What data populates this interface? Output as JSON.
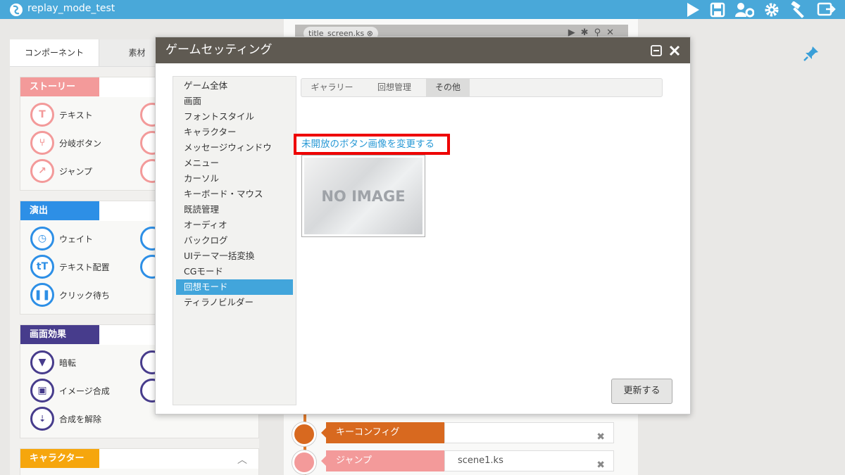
{
  "app": {
    "title": "replay_mode_test"
  },
  "toolbar": {
    "icons": [
      "play-icon",
      "save-icon",
      "users-gear-icon",
      "settings-icon",
      "hammer-icon",
      "export-icon"
    ]
  },
  "left_panel": {
    "tabs": [
      {
        "label": "コンポーネント"
      },
      {
        "label": "素材"
      }
    ],
    "categories": [
      {
        "label": "ストーリー",
        "color": "#f39a9a",
        "items": [
          {
            "label": "テキスト"
          },
          {
            "label": "分岐ボタン"
          },
          {
            "label": "ジャンプ"
          }
        ]
      },
      {
        "label": "演出",
        "color": "#2d8fe6",
        "items": [
          {
            "label": "ウェイト"
          },
          {
            "label": "テキスト配置"
          },
          {
            "label": "クリック待ち"
          }
        ]
      },
      {
        "label": "画面効果",
        "color": "#473c8c",
        "items": [
          {
            "label": "暗転"
          },
          {
            "label": "イメージ合成"
          },
          {
            "label": "合成を解除"
          }
        ]
      },
      {
        "label": "キャラクター",
        "color": "#f6a60d"
      }
    ]
  },
  "editor": {
    "file_tab": "title_screen.ks",
    "timeline": [
      {
        "label": "キーコンフィグ",
        "value": "",
        "color": "#d8691f"
      },
      {
        "label": "ジャンプ",
        "value": "scene1.ks",
        "color": "#f39a9a"
      }
    ]
  },
  "dialog": {
    "title": "ゲームセッティング",
    "settings_items": [
      "ゲーム全体",
      "画面",
      "フォントスタイル",
      "キャラクター",
      "メッセージウィンドウ",
      "メニュー",
      "カーソル",
      "キーボード・マウス",
      "既読管理",
      "オーディオ",
      "バックログ",
      "UIテーマ一括変換",
      "CGモード",
      "回想モード",
      "ティラノビルダー"
    ],
    "active_item": "回想モード",
    "tabs": [
      {
        "label": "ギャラリー"
      },
      {
        "label": "回想管理"
      },
      {
        "label": "その他"
      }
    ],
    "active_tab": "その他",
    "change_link": "未開放のボタン画像を変更する",
    "no_image_text": "NO IMAGE",
    "update_button": "更新する"
  },
  "colors": {
    "accent": "#49a8d9",
    "highlight": "#ee0000",
    "dialog_header": "#5f5a52"
  }
}
